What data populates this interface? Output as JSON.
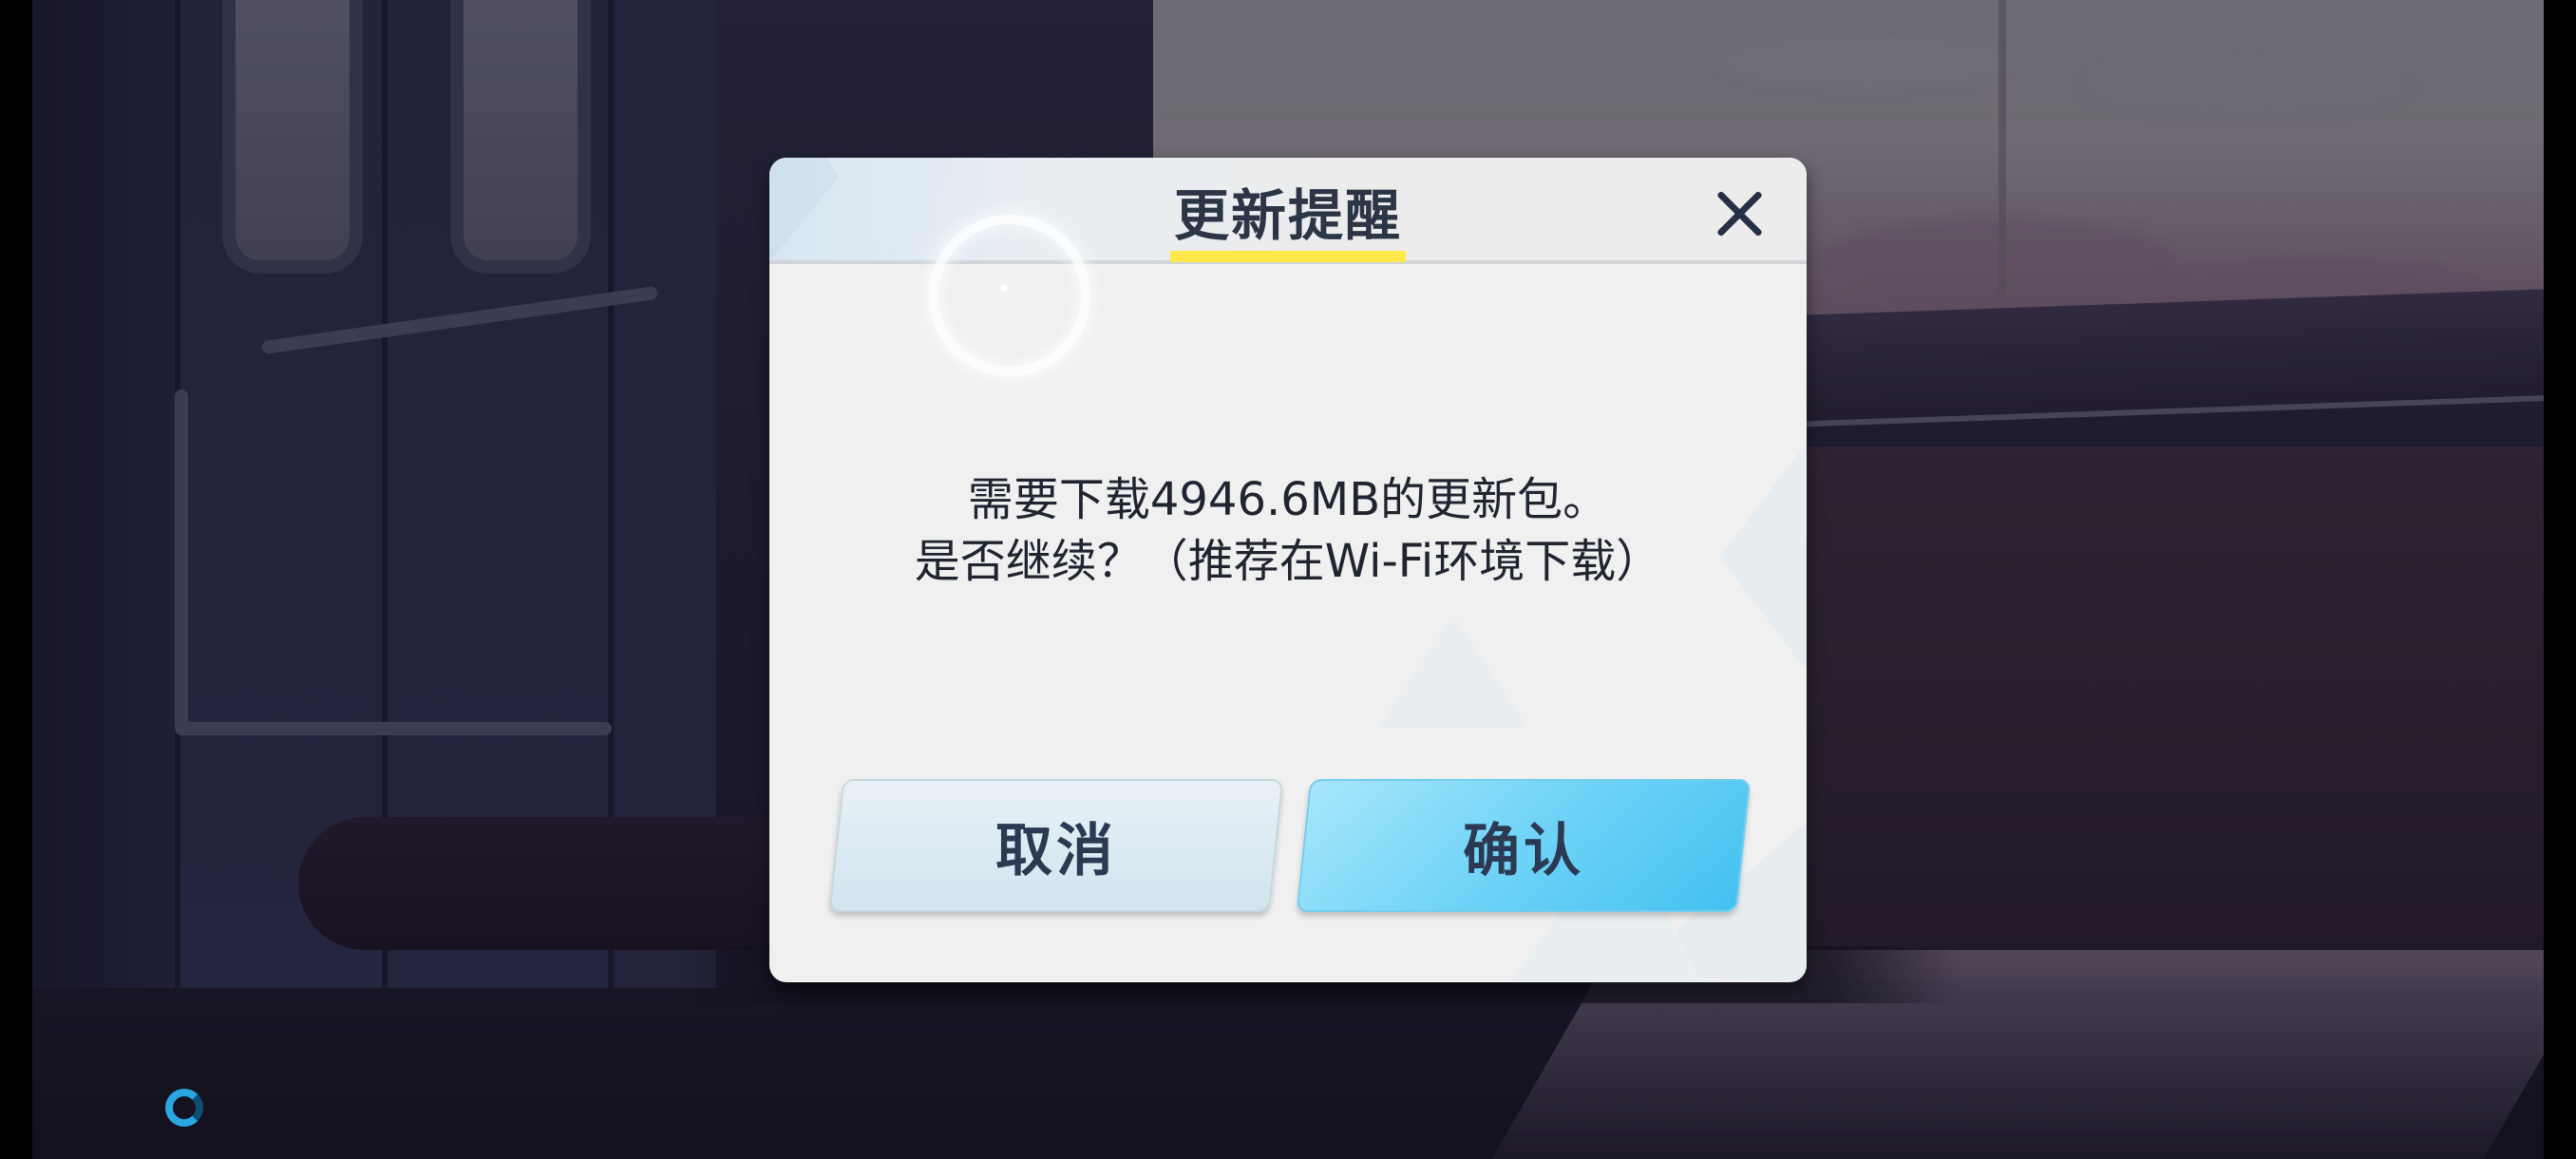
{
  "dialog": {
    "title": "更新提醒",
    "message_line1": "需要下载4946.6MB的更新包。",
    "message_line2": "是否继续？（推荐在Wi-Fi环境下载）",
    "cancel_label": "取消",
    "confirm_label": "确认",
    "close_icon": "close-icon"
  },
  "colors": {
    "title_underline": "#ffe84a",
    "confirm_button": "#6fd3f7",
    "cancel_button": "#d2e4ef",
    "text_dark": "#2b3546"
  },
  "background": {
    "scene": "train interior with window at dusk"
  }
}
